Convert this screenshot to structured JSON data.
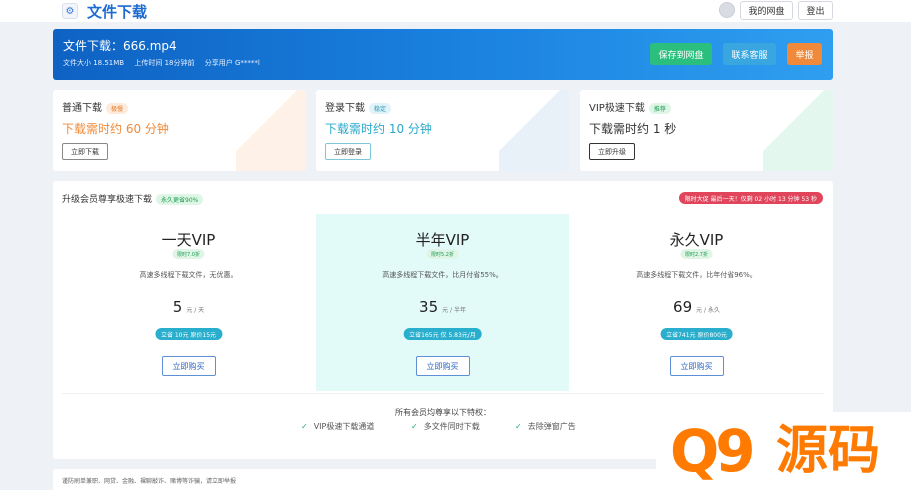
{
  "header": {
    "logo_glyph": "⚙",
    "title": "文件下载",
    "my_disk": "我的网盘",
    "logout": "登出"
  },
  "banner": {
    "title": "文件下载：666.mp4",
    "size": "文件大小 18.51MB",
    "upload_time": "上传时间 18分钟前",
    "sharer": "分享用户 G*****l",
    "save": "保存到网盘",
    "support": "联系客服",
    "report": "举报",
    "colors": {
      "save": "#2bbf7d",
      "support": "#3aa6e0",
      "report": "#f08a3a"
    }
  },
  "options": [
    {
      "title": "普通下载",
      "badge": "极慢",
      "time": "下载需时约 60 分钟",
      "button": "立即下载",
      "color": "#f08a3a",
      "badge_bg": "#fdeadb"
    },
    {
      "title": "登录下载",
      "badge": "稳定",
      "time": "下载需时约 10 分钟",
      "button": "立即登录",
      "color": "#2aa8c8",
      "badge_bg": "#dff3f8"
    },
    {
      "title": "VIP极速下载",
      "badge": "推荐",
      "time": "下载需时约 1 秒",
      "button": "立即升级",
      "color": "#333333",
      "badge_bg": "#dff5e6"
    }
  ],
  "upgrade": {
    "title": "升级会员尊享极速下载",
    "title_badge": "永久更省90%",
    "countdown": "限时大促 最后一天！仅剩 02 小时 13 分钟 53 秒",
    "plans": [
      {
        "name": "一天VIP",
        "tag": "限时7.0折",
        "desc": "高速多线程下载文件，无优惠。",
        "price": "5",
        "unit": "元 / 天",
        "save": "立省 10元 原价15元",
        "buy": "立即购买"
      },
      {
        "name": "半年VIP",
        "tag": "限时5.2折",
        "desc": "高速多线程下载文件，比月付省55%。",
        "price": "35",
        "unit": "元 / 半年",
        "save": "立省165元 仅 5.83元/月",
        "buy": "立即购买"
      },
      {
        "name": "永久VIP",
        "tag": "限时2.7折",
        "desc": "高速多线程下载文件，比年付省96%。",
        "price": "69",
        "unit": "元 / 永久",
        "save": "立省741元 原价800元",
        "buy": "立即购买"
      }
    ],
    "privileges_title": "所有会员均尊享以下特权：",
    "privileges": [
      "VIP极速下载通道",
      "多文件同时下载",
      "去除弹窗广告"
    ]
  },
  "footer": {
    "notice": "谨防刷单兼职、网贷、金融、裸聊敲诈、赌博等诈骗，请立即举报"
  },
  "watermark": {
    "q": "Q9",
    "text": "源码"
  }
}
